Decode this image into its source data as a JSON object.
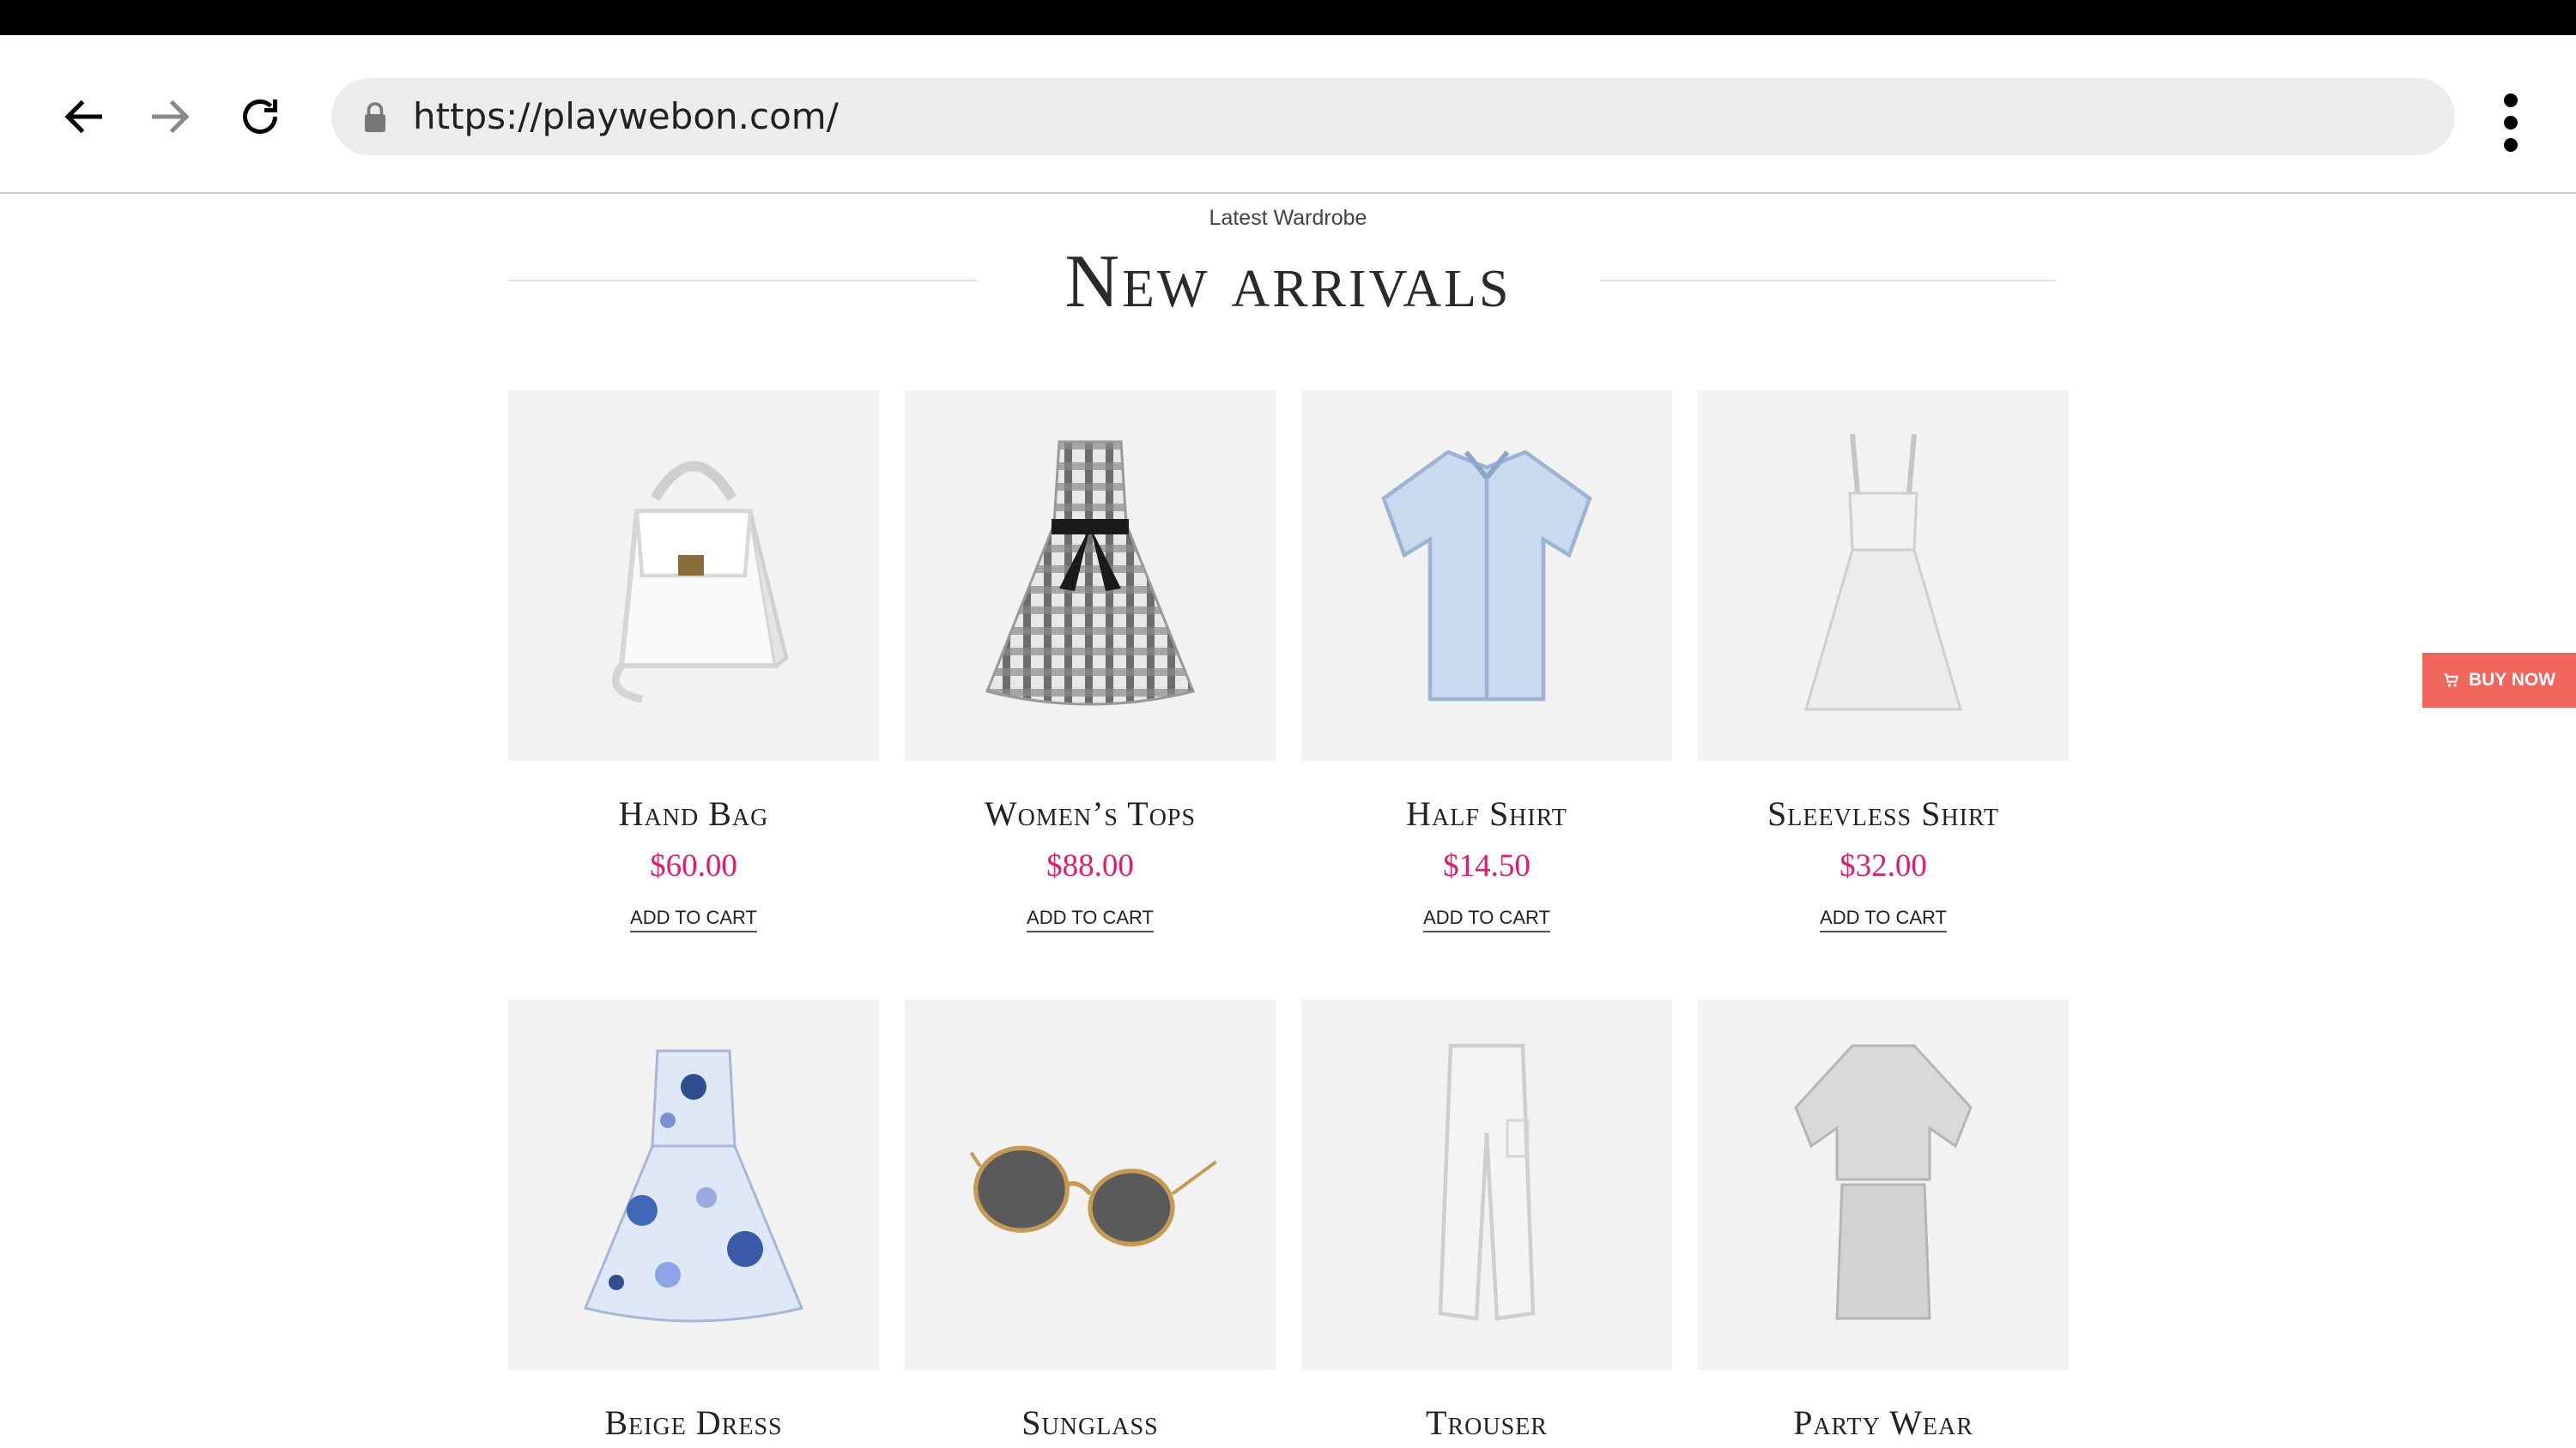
{
  "browser": {
    "url": "https://playwebon.com/"
  },
  "section": {
    "eyebrow": "Latest Wardrobe",
    "title": "New arrivals"
  },
  "buy_now": {
    "label": "BUY NOW"
  },
  "colors": {
    "price": "#e21b70",
    "buy_now_bg": "#f0665c",
    "card_bg": "#f2f2f2"
  },
  "products": [
    {
      "name": "Hand Bag",
      "price": "$60.00",
      "cta": "ADD TO CART",
      "icon": "handbag-icon"
    },
    {
      "name": "Women’s Tops",
      "price": "$88.00",
      "cta": "ADD TO CART",
      "icon": "plaid-dress-icon"
    },
    {
      "name": "Half Shirt",
      "price": "$14.50",
      "cta": "ADD TO CART",
      "icon": "shirt-icon"
    },
    {
      "name": "Sleevless Shirt",
      "price": "$32.00",
      "cta": "ADD TO CART",
      "icon": "sleeveless-dress-icon"
    },
    {
      "name": "Beige Dress",
      "icon": "polka-dress-icon"
    },
    {
      "name": "Sunglass",
      "icon": "sunglasses-icon"
    },
    {
      "name": "Trouser",
      "icon": "trouser-icon"
    },
    {
      "name": "Party Wear",
      "icon": "party-wear-icon"
    }
  ]
}
